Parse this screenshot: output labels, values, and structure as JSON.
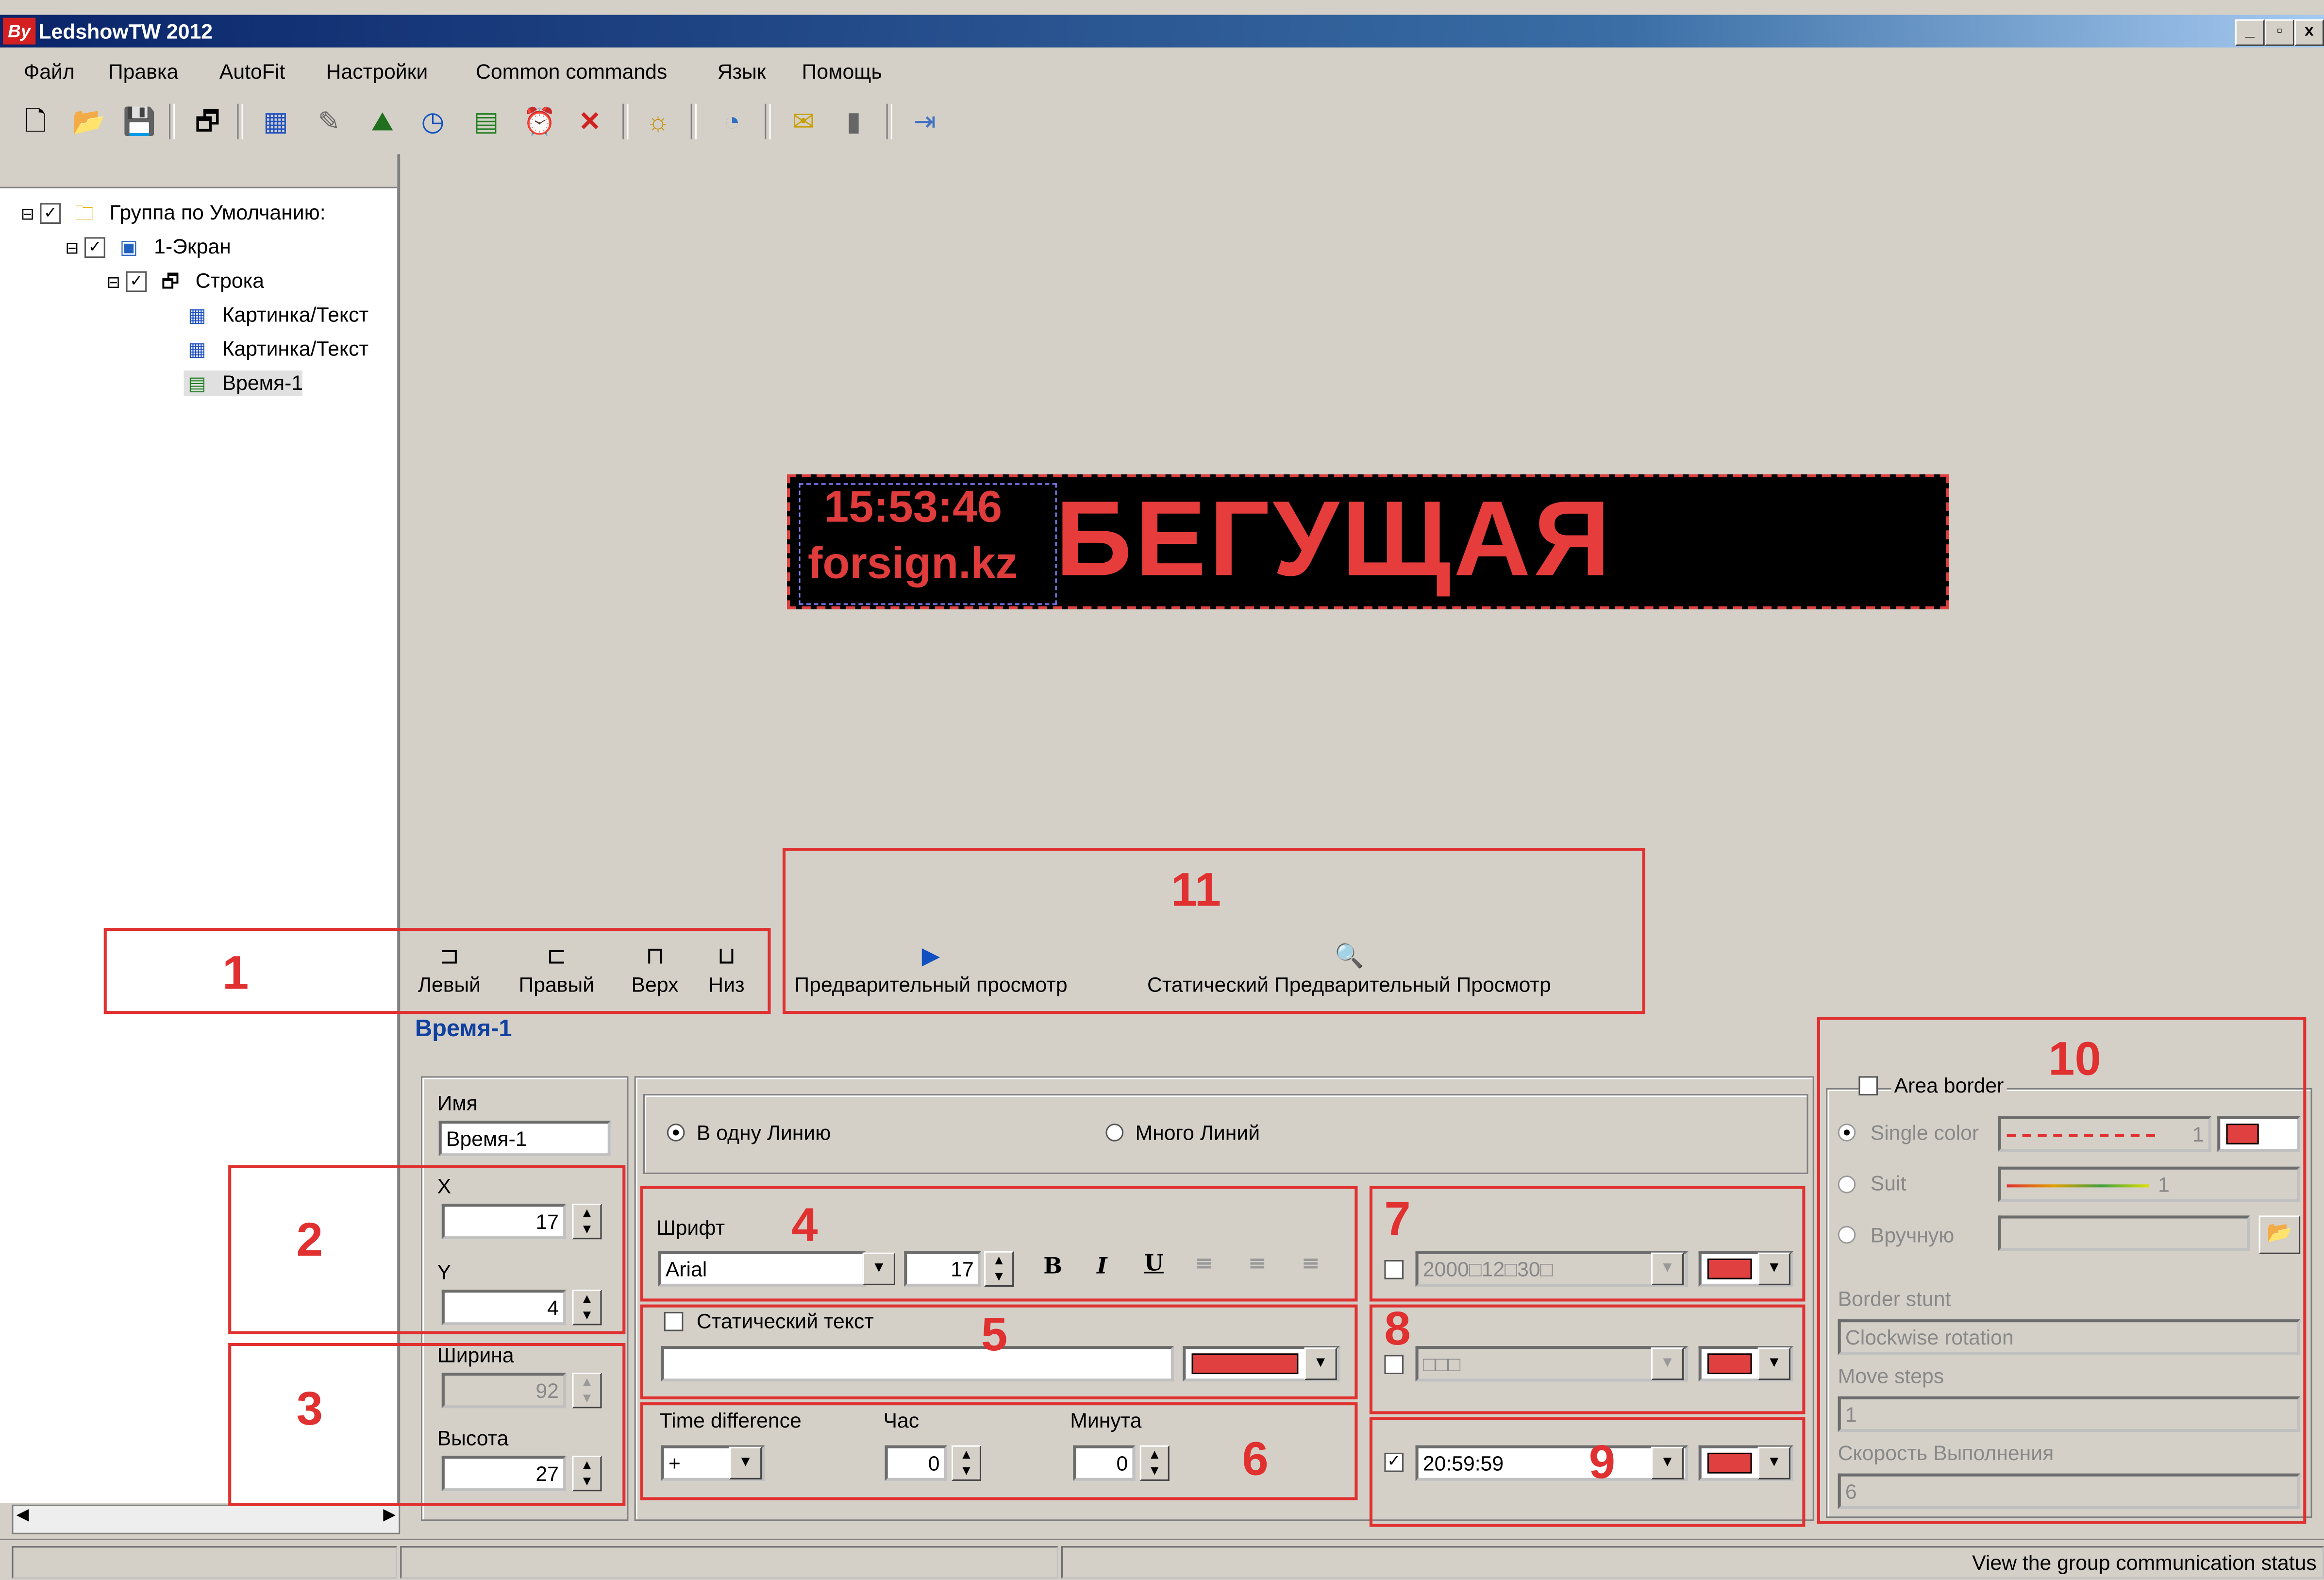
{
  "window": {
    "title": "LedshowTW 2012",
    "minimize": "_",
    "maximize": "▫",
    "close": "x"
  },
  "menu": [
    "Файл",
    "Правка",
    "AutoFit",
    "Настройки",
    "Common commands",
    "Язык",
    "Помощь"
  ],
  "toolbar_icons": [
    "new-icon",
    "open-icon",
    "save-icon",
    "screens-icon",
    "text-area-icon",
    "edit-icon",
    "picture-icon",
    "clock-icon",
    "time-area-icon",
    "alarm-icon",
    "delete-icon",
    "brightness-icon",
    "time-sync-icon",
    "send-icon",
    "download-icon",
    "exit-icon"
  ],
  "tree": {
    "items": [
      {
        "label": "Группа по Умолчанию:",
        "checked": true,
        "icon": "folder-icon"
      },
      {
        "label": "1-Экран",
        "checked": true,
        "icon": "monitor-icon"
      },
      {
        "label": "Строка",
        "checked": true,
        "icon": "program-icon"
      },
      {
        "label": "Картинка/Текст",
        "icon": "text-area-icon"
      },
      {
        "label": "Картинка/Текст",
        "icon": "text-area-icon"
      },
      {
        "label": "Время-1",
        "icon": "time-area-icon"
      }
    ]
  },
  "led": {
    "time": "15:53:46",
    "site": "forsign.kz",
    "text": "БЕГУЩАЯ",
    "color": "#e63c3c"
  },
  "align_tools": {
    "left": "Левый",
    "right": "Правый",
    "top": "Верх",
    "bottom": "Низ"
  },
  "preview_tools": {
    "preview": "Предварительный просмотр",
    "static_preview": "Статический Предварительный Просмотр"
  },
  "annotations": [
    "1",
    "2",
    "3",
    "4",
    "5",
    "6",
    "7",
    "8",
    "9",
    "10",
    "11"
  ],
  "props": {
    "title": "Время-1",
    "name_label": "Имя",
    "name_value": "Время-1",
    "x_label": "X",
    "x_value": "17",
    "y_label": "Y",
    "y_value": "4",
    "width_label": "Ширина",
    "width_value": "92",
    "height_label": "Высота",
    "height_value": "27",
    "mode_single": "В одну Линию",
    "mode_multi": "Много Линий",
    "font_label": "Шрифт",
    "font_value": "Arial",
    "font_size": "17",
    "bold": "B",
    "italic": "I",
    "underline": "U",
    "static_text_label": "Статический текст",
    "time_diff_label": "Time difference",
    "time_diff_value": "+",
    "hour_label": "Час",
    "hour_value": "0",
    "minute_label": "Минута",
    "minute_value": "0",
    "date_format": "2000□12□30□",
    "week_format": "□□□",
    "time_format": "20:59:59",
    "text_color": "#e04040"
  },
  "border": {
    "area_border_label": "Area border",
    "single_color_label": "Single color",
    "single_value": "1",
    "suit_label": "Suit",
    "suit_value": "1",
    "manual_label": "Вручную",
    "stunt_label": "Border stunt",
    "stunt_value": "Clockwise rotation",
    "steps_label": "Move steps",
    "steps_value": "1",
    "speed_label": "Скорость Выполнения",
    "speed_value": "6"
  },
  "status": {
    "right": "View the group communication status"
  }
}
